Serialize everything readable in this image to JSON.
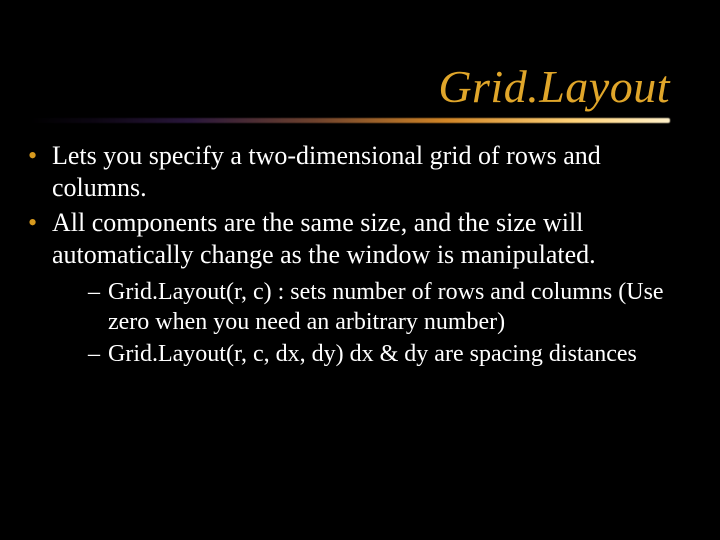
{
  "title": "Grid.Layout",
  "bullets": [
    "Lets you specify a two-dimensional grid of rows and columns.",
    "All components are the same size, and the size will automatically change as the window is manipulated."
  ],
  "subbullets": [
    "Grid.Layout(r, c) : sets number of rows and columns (Use zero when you need an arbitrary number)",
    "Grid.Layout(r, c, dx, dy) dx & dy are spacing distances"
  ]
}
